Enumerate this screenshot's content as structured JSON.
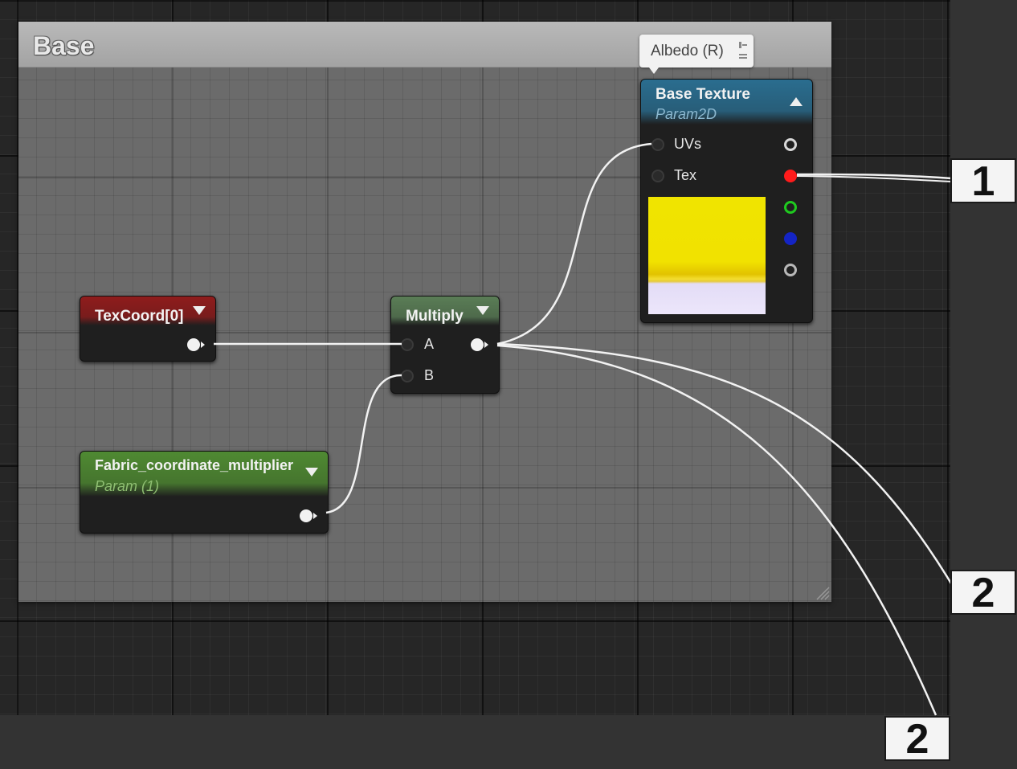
{
  "comment": {
    "title": "Base"
  },
  "tooltip": {
    "text": "Albedo (R)"
  },
  "nodes": {
    "texcoord": {
      "title": "TexCoord[0]",
      "header_color": "#8f1c1c"
    },
    "fabric": {
      "title": "Fabric_coordinate_multiplier",
      "subtitle": "Param (1)",
      "header_color": "#4f8a32"
    },
    "multiply": {
      "title": "Multiply",
      "header_color": "#5a7d56",
      "pins": [
        "A",
        "B"
      ]
    },
    "base_texture": {
      "title": "Base Texture",
      "subtitle": "Param2D",
      "header_color": "#2a6d8f",
      "pins": [
        "UVs",
        "Tex"
      ],
      "output_colors": [
        "#d8d8d8",
        "#ff1b1b",
        "#1fc91f",
        "#1424c4",
        "#b8b8b8"
      ]
    }
  },
  "callouts": [
    "1",
    "2",
    "2"
  ],
  "colors": {
    "wire": "#f2f2f2",
    "graph_background": "#262626",
    "comment_background": "#6b6b6b"
  }
}
